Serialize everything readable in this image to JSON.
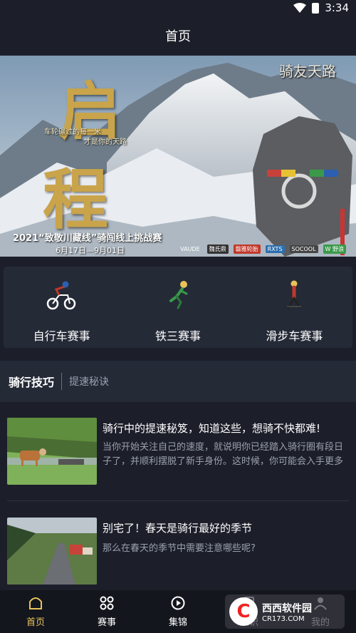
{
  "status_bar": {
    "time": "3:34"
  },
  "header": {
    "title": "首页"
  },
  "banner": {
    "title_chars": [
      "启",
      "程"
    ],
    "tagline_1": "车轮碾过的每一米",
    "tagline_2": "才是你的天路",
    "logo_text": "骑友天路",
    "campaign": "2021“致敬川藏线”骑闯线上挑战赛",
    "dates": "6月17日—9月01日",
    "sponsors": [
      "VAUDE",
      "魏氏鼎",
      "磐雅轮胎",
      "RXTS",
      "SOCOOL",
      "W 野浪"
    ]
  },
  "categories": [
    {
      "label": "自行车赛事",
      "icon": "bicycle-icon"
    },
    {
      "label": "铁三赛事",
      "icon": "triathlon-icon"
    },
    {
      "label": "滑步车赛事",
      "icon": "balance-bike-icon"
    }
  ],
  "section": {
    "active_tab": "骑行技巧",
    "tab": "提速秘诀"
  },
  "articles": [
    {
      "title": "骑行中的提速秘笈，知道这些，想骑不快都难!",
      "excerpt": "当你开始关注自己的速度，就说明你已经踏入骑行圈有段日子了，并顺利摆脱了新手身份。这时候，你可能会入手更多"
    },
    {
      "title": "别宅了！春天是骑行最好的季节",
      "excerpt": "那么在春天的季节中需要注意哪些呢?"
    }
  ],
  "bottom_nav": [
    {
      "label": "首页",
      "icon": "home-icon",
      "active": true
    },
    {
      "label": "赛事",
      "icon": "events-icon",
      "active": false
    },
    {
      "label": "集锦",
      "icon": "play-icon",
      "active": false
    },
    {
      "label": "知识",
      "icon": "knowledge-icon",
      "active": false
    },
    {
      "label": "我的",
      "icon": "profile-icon",
      "active": false
    }
  ],
  "watermark": {
    "name": "西西软件园",
    "url": "CR173.COM"
  },
  "colors": {
    "background": "#1c1f2a",
    "card": "#252a37",
    "nav_active": "#e8c35a",
    "muted_text": "#9aa0ad"
  }
}
